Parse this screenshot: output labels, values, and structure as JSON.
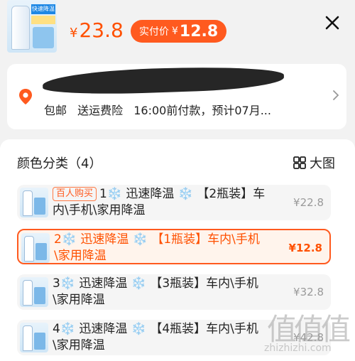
{
  "product": {
    "thumb_label": "快速降温"
  },
  "price": {
    "currency": "¥",
    "original": "23.8",
    "pay_label": "实付价",
    "pay_currency": "¥",
    "pay_value": "12.8"
  },
  "address": {
    "shipping": "包邮",
    "insurance": "送运费险",
    "deadline": "16:00前付款，预计07月..."
  },
  "section": {
    "title": "颜色分类（4）",
    "big_view": "大图"
  },
  "options": [
    {
      "badge": "百人购买",
      "text": "1❄️ 迅速降温 ❄️ 【2瓶装】车内\\手机\\家用降温",
      "price": "¥22.8",
      "selected": false
    },
    {
      "badge": "",
      "text": "2❄️ 迅速降温 ❄️ 【1瓶装】车内\\手机\\家用降温",
      "price": "¥12.8",
      "selected": true
    },
    {
      "badge": "",
      "text": "3❄️ 迅速降温 ❄️ 【3瓶装】车内\\手机\\家用降温",
      "price": "¥32.8",
      "selected": false
    },
    {
      "badge": "",
      "text": "4❄️ 迅速降温 ❄️ 【4瓶装】车内\\手机\\家用降温",
      "price": "¥42.8",
      "selected": false
    }
  ],
  "watermark": {
    "glyphs": "值值值",
    "url": "zhizhizhi.com"
  },
  "colors": {
    "accent": "#ff5000",
    "pill": "#ff5a1f"
  }
}
